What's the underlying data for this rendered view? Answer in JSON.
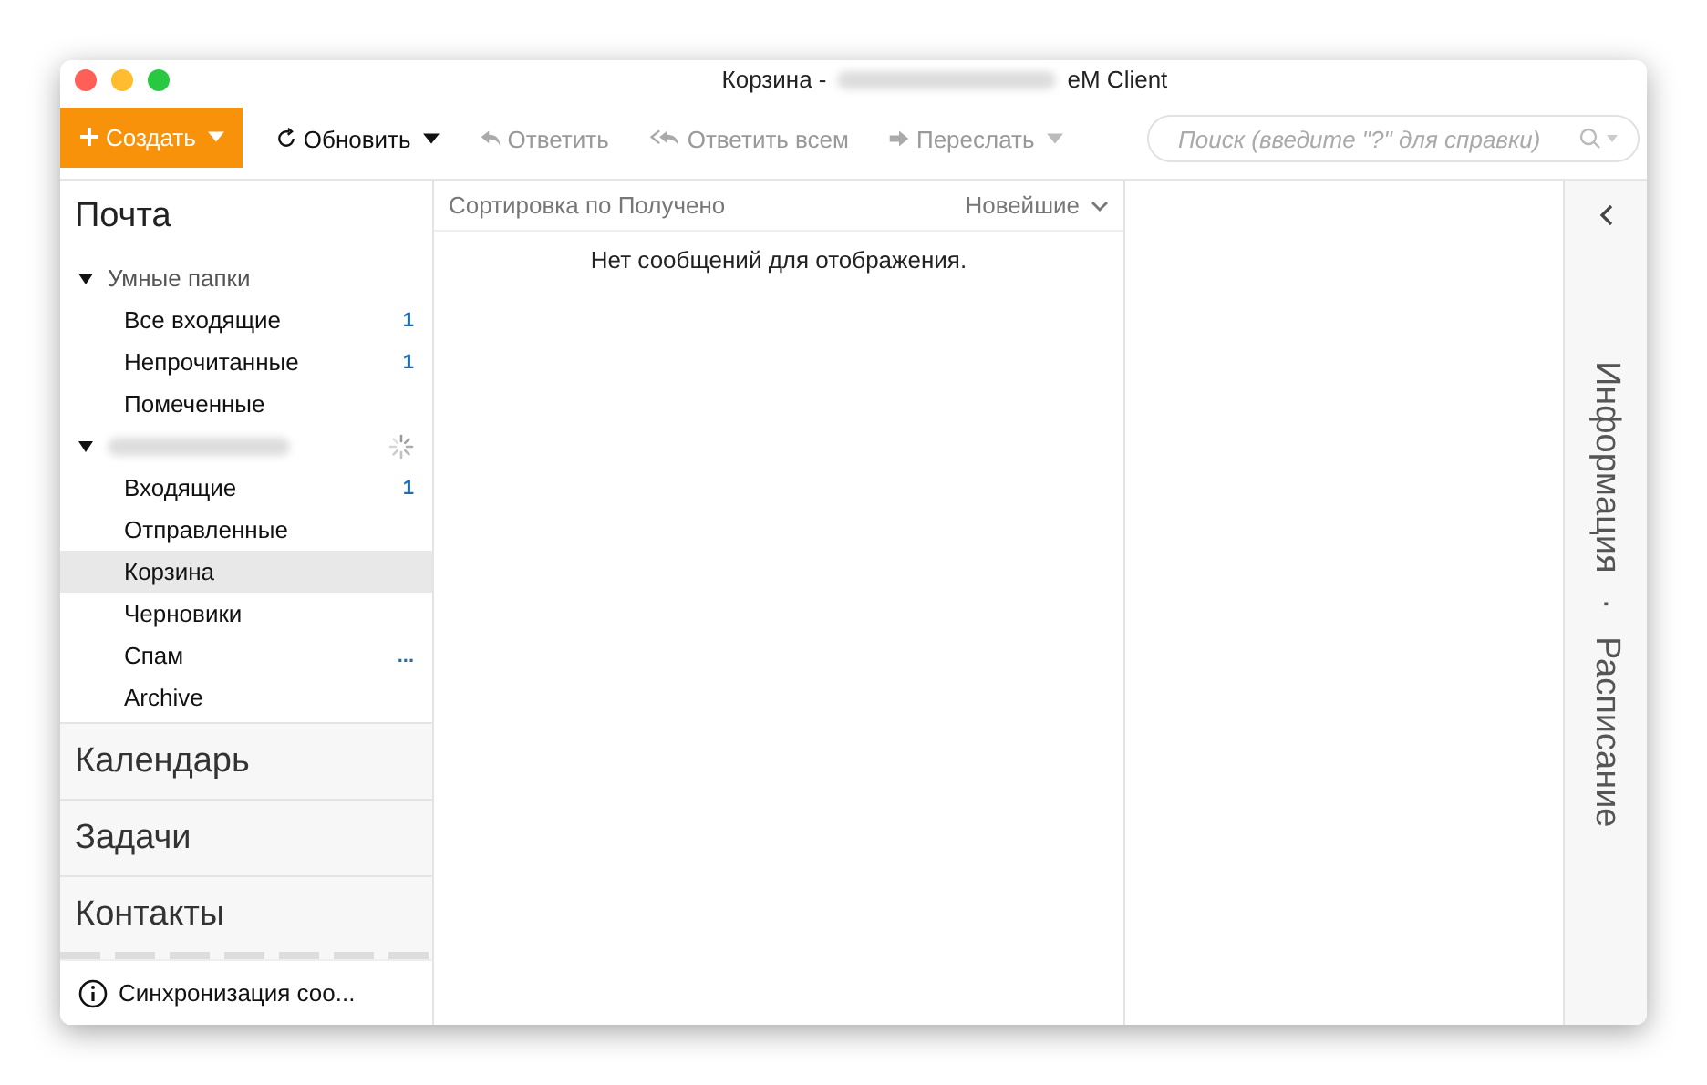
{
  "window": {
    "title_prefix": "Корзина -",
    "title_suffix": "eM Client"
  },
  "toolbar": {
    "buttons": [
      {
        "kind": "create",
        "label": "Создать",
        "disabled": false
      },
      {
        "kind": "refresh",
        "label": "Обновить",
        "disabled": false
      },
      {
        "kind": "reply",
        "label": "Ответить",
        "disabled": true
      },
      {
        "kind": "reply_all",
        "label": "Ответить всем",
        "disabled": true
      },
      {
        "kind": "forward",
        "label": "Переслать",
        "disabled": true
      }
    ],
    "search": {
      "placeholder": "Поиск (введите \"?\" для справки)"
    }
  },
  "sidebar": {
    "title": "Почта",
    "folders": [
      {
        "kind": "group",
        "label": "Умные папки",
        "expanded": true,
        "children": [
          {
            "label": "Все входящие",
            "count": "1",
            "selected": false
          },
          {
            "label": "Непрочитанные",
            "count": "1",
            "selected": false
          },
          {
            "label": "Помеченные",
            "selected": false
          }
        ]
      },
      {
        "kind": "account",
        "expanded": true,
        "syncing": true,
        "children": [
          {
            "label": "Входящие",
            "count": "1",
            "selected": false
          },
          {
            "label": "Отправленные",
            "selected": false
          },
          {
            "label": "Корзина",
            "selected": true
          },
          {
            "label": "Черновики",
            "selected": false
          },
          {
            "label": "Спам",
            "count": "...",
            "selected": false
          },
          {
            "label": "Archive",
            "selected": false
          }
        ]
      }
    ],
    "sections": [
      "Календарь",
      "Задачи",
      "Контакты"
    ],
    "status": "Синхронизация соо..."
  },
  "message_list": {
    "sort_label": "Сортировка по Получено",
    "order": "Новейшие",
    "empty_text": "Нет сообщений для отображения."
  },
  "right_panel": {
    "tabs": [
      "Информация",
      "Расписание"
    ],
    "separator": "·"
  }
}
